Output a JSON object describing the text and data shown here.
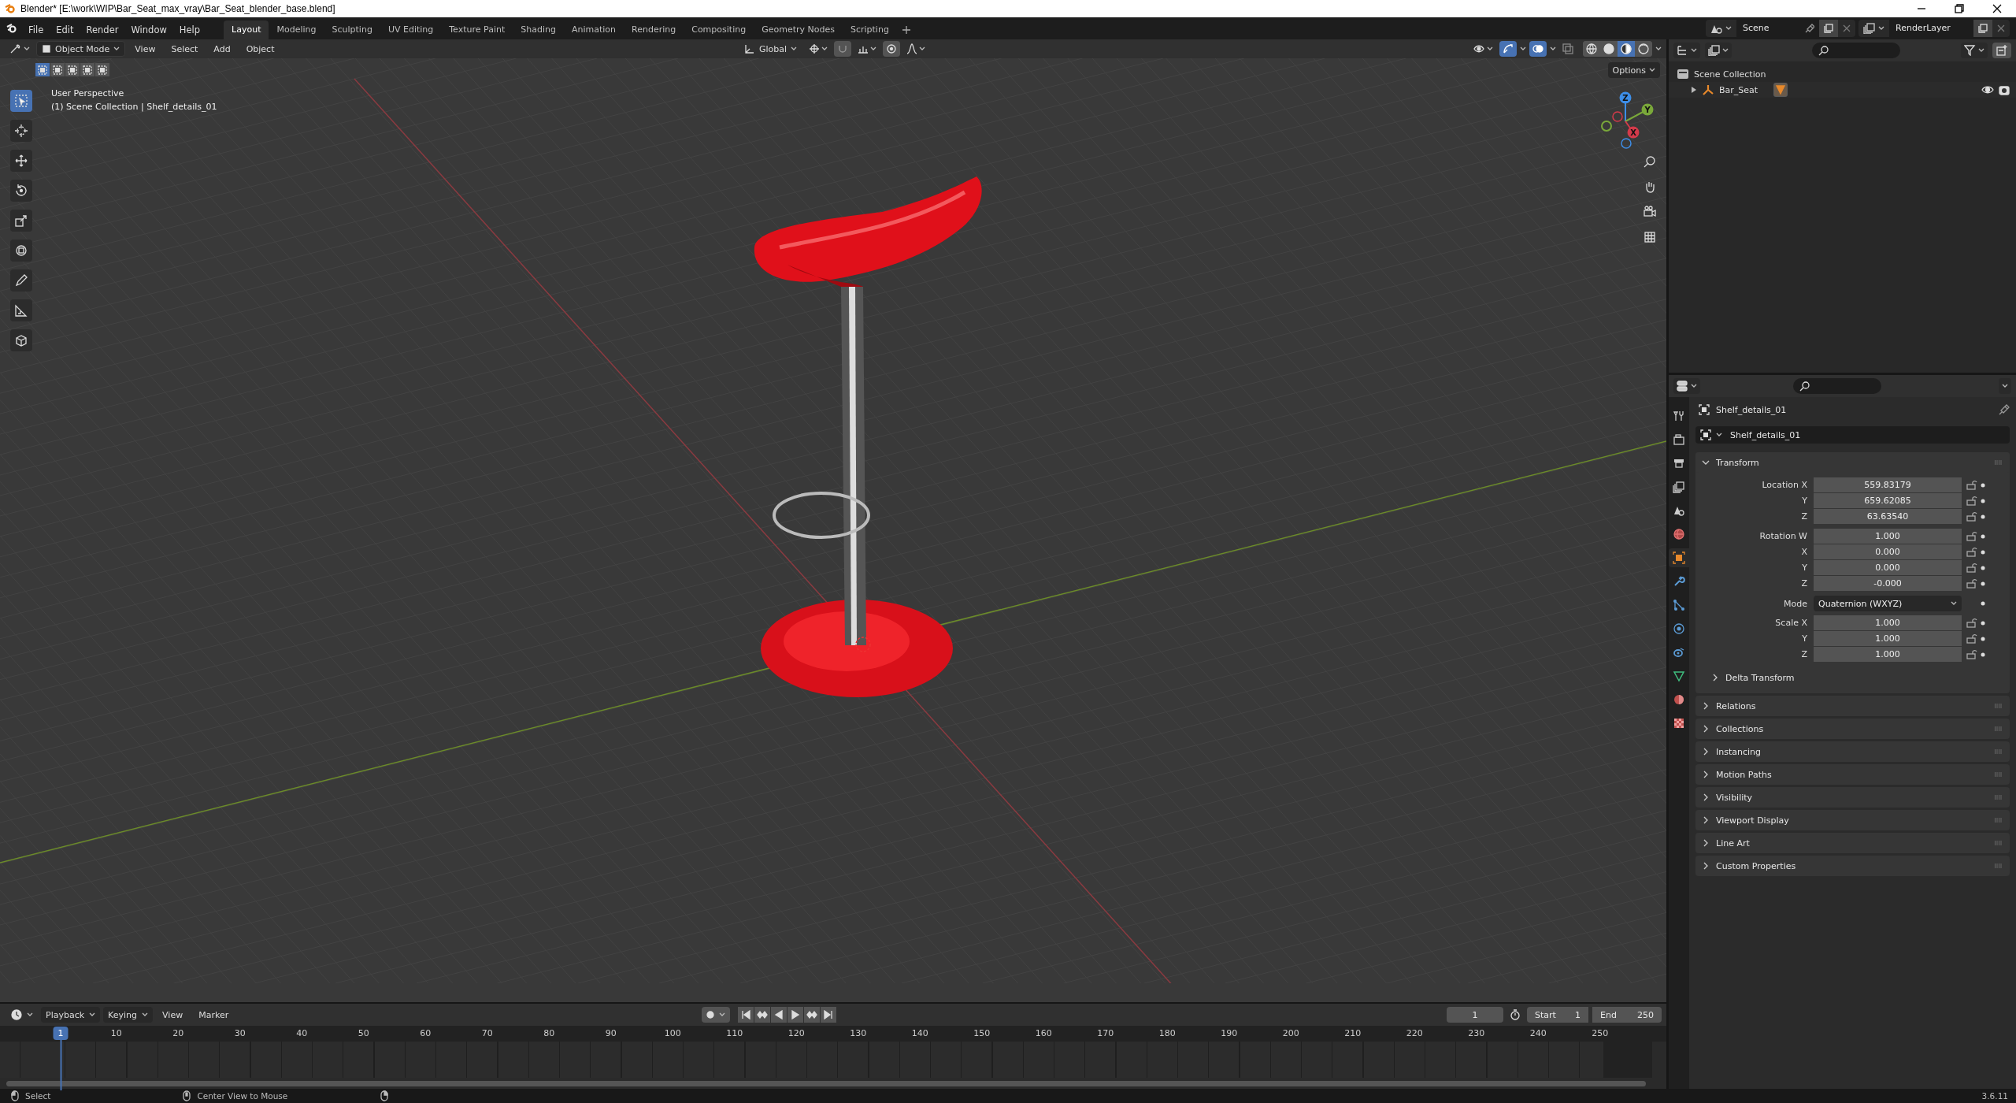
{
  "window": {
    "title": "Blender* [E:\\work\\WIP\\Bar_Seat_max_vray\\Bar_Seat_blender_base.blend]"
  },
  "menus": [
    "File",
    "Edit",
    "Render",
    "Window",
    "Help"
  ],
  "workspaces": [
    {
      "label": "Layout",
      "selected": true
    },
    {
      "label": "Modeling",
      "selected": false
    },
    {
      "label": "Sculpting",
      "selected": false
    },
    {
      "label": "UV Editing",
      "selected": false
    },
    {
      "label": "Texture Paint",
      "selected": false
    },
    {
      "label": "Shading",
      "selected": false
    },
    {
      "label": "Animation",
      "selected": false
    },
    {
      "label": "Rendering",
      "selected": false
    },
    {
      "label": "Compositing",
      "selected": false
    },
    {
      "label": "Geometry Nodes",
      "selected": false
    },
    {
      "label": "Scripting",
      "selected": false
    }
  ],
  "scene": {
    "name": "Scene",
    "view_layer": "RenderLayer"
  },
  "viewport": {
    "mode": "Object Mode",
    "menus": [
      "View",
      "Select",
      "Add",
      "Object"
    ],
    "orientation": "Global",
    "options": "Options",
    "info": [
      "User Perspective",
      "(1) Scene Collection | Shelf_details_01"
    ],
    "select_modes": [
      {
        "selected": true
      },
      {
        "selected": false
      },
      {
        "selected": false
      },
      {
        "selected": false
      },
      {
        "selected": false
      }
    ],
    "tools": [
      {
        "kind": "select",
        "selected": true
      },
      {
        "kind": "cursor",
        "selected": false
      },
      {
        "kind": "move",
        "selected": false
      },
      {
        "kind": "rotate",
        "selected": false
      },
      {
        "kind": "scale",
        "selected": false
      },
      {
        "kind": "transform",
        "selected": false
      },
      {
        "kind": "annotate",
        "selected": false
      },
      {
        "kind": "measure",
        "selected": false
      },
      {
        "kind": "add-cube",
        "selected": false
      }
    ],
    "shading": [
      {
        "kind": "wireframe",
        "selected": false
      },
      {
        "kind": "solid",
        "selected": false
      },
      {
        "kind": "material",
        "selected": true
      },
      {
        "kind": "rendered",
        "selected": false
      }
    ],
    "gizmo": [
      "Z",
      "Y",
      "X"
    ]
  },
  "timeline": {
    "menus": [
      "Playback",
      "Keying",
      "View",
      "Marker"
    ],
    "current_frame": "1",
    "start_label": "Start",
    "start": "1",
    "end_label": "End",
    "end": "250",
    "playhead": "1",
    "ticks": [
      "10",
      "20",
      "30",
      "40",
      "50",
      "60",
      "70",
      "80",
      "90",
      "100",
      "110",
      "120",
      "130",
      "140",
      "150",
      "160",
      "170",
      "180",
      "190",
      "200",
      "210",
      "220",
      "230",
      "240",
      "250"
    ]
  },
  "outliner": {
    "items": [
      {
        "label": "Scene Collection",
        "children": [
          {
            "label": "Bar_Seat",
            "expanded": false
          }
        ]
      }
    ]
  },
  "properties": {
    "tabs": [
      {
        "kind": "tool",
        "selected": false
      },
      {
        "kind": "render",
        "selected": false
      },
      {
        "kind": "output",
        "selected": false
      },
      {
        "kind": "view_layer",
        "selected": false
      },
      {
        "kind": "scene",
        "selected": false
      },
      {
        "kind": "world",
        "selected": false
      },
      {
        "kind": "object",
        "selected": true
      },
      {
        "kind": "modifiers",
        "selected": false
      },
      {
        "kind": "particles",
        "selected": false
      },
      {
        "kind": "physics",
        "selected": false
      },
      {
        "kind": "constraints",
        "selected": false
      },
      {
        "kind": "data",
        "selected": false
      },
      {
        "kind": "material",
        "selected": false
      },
      {
        "kind": "texture",
        "selected": false
      }
    ],
    "context": "Shelf_details_01",
    "object_name": "Shelf_details_01",
    "transform": {
      "title": "Transform",
      "expanded": true,
      "groups": [
        {
          "rows": [
            {
              "kind": "number",
              "label": "Location X",
              "value": "559.83179"
            },
            {
              "kind": "number",
              "label": "Y",
              "value": "659.62085"
            },
            {
              "kind": "number",
              "label": "Z",
              "value": "63.63540"
            }
          ]
        },
        {
          "rows": [
            {
              "kind": "number",
              "label": "Rotation W",
              "value": "1.000"
            },
            {
              "kind": "number",
              "label": "X",
              "value": "0.000"
            },
            {
              "kind": "number",
              "label": "Y",
              "value": "0.000"
            },
            {
              "kind": "number",
              "label": "Z",
              "value": "-0.000"
            }
          ]
        },
        {
          "rows": [
            {
              "kind": "dropdown",
              "label": "Mode",
              "value": "Quaternion (WXYZ)"
            }
          ]
        },
        {
          "rows": [
            {
              "kind": "number",
              "label": "Scale X",
              "value": "1.000"
            },
            {
              "kind": "number",
              "label": "Y",
              "value": "1.000"
            },
            {
              "kind": "number",
              "label": "Z",
              "value": "1.000"
            }
          ]
        }
      ],
      "subpanels": [
        {
          "title": "Delta Transform",
          "expanded": false
        }
      ]
    },
    "panels": [
      {
        "title": "Relations",
        "expanded": false
      },
      {
        "title": "Collections",
        "expanded": false
      },
      {
        "title": "Instancing",
        "expanded": false
      },
      {
        "title": "Motion Paths",
        "expanded": false
      },
      {
        "title": "Visibility",
        "expanded": false
      },
      {
        "title": "Viewport Display",
        "expanded": false
      },
      {
        "title": "Line Art",
        "expanded": false
      },
      {
        "title": "Custom Properties",
        "expanded": false
      }
    ]
  },
  "status_bar": {
    "items": [
      "Select",
      "Center View to Mouse"
    ],
    "version": "3.6.11"
  }
}
